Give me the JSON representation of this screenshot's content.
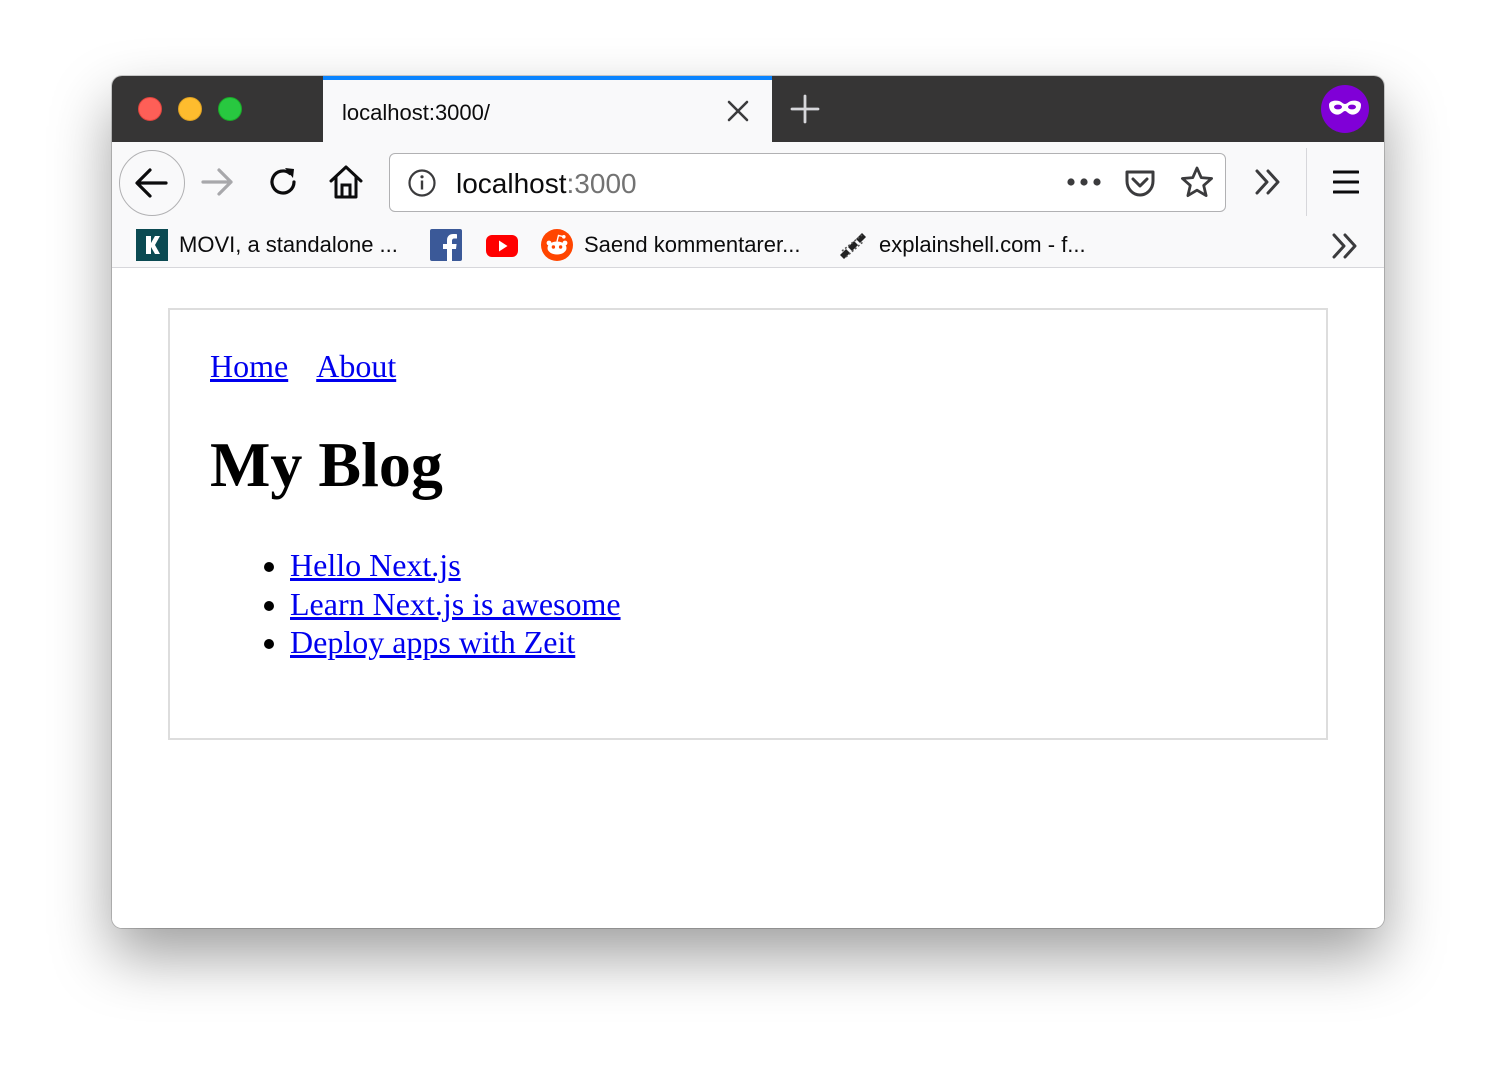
{
  "browser": {
    "tab": {
      "title": "localhost:3000/"
    },
    "url": {
      "host": "localhost",
      "port": ":3000"
    },
    "bookmarks": [
      {
        "label": "MOVI, a standalone ...",
        "icon": "movi-favicon"
      },
      {
        "label": "",
        "icon": "facebook-favicon"
      },
      {
        "label": "",
        "icon": "youtube-favicon"
      },
      {
        "label": "Saend kommentarer...",
        "icon": "reddit-favicon"
      },
      {
        "label": "explainshell.com - f...",
        "icon": "explainshell-favicon"
      }
    ],
    "colors": {
      "tab_accent": "#0a84ff",
      "private_mask": "#8000d7",
      "chrome_dark": "#363535"
    }
  },
  "page": {
    "nav": [
      "Home",
      "About"
    ],
    "title": "My Blog",
    "posts": [
      "Hello Next.js",
      "Learn Next.js is awesome",
      "Deploy apps with Zeit"
    ],
    "link_color": "#0000ee"
  }
}
